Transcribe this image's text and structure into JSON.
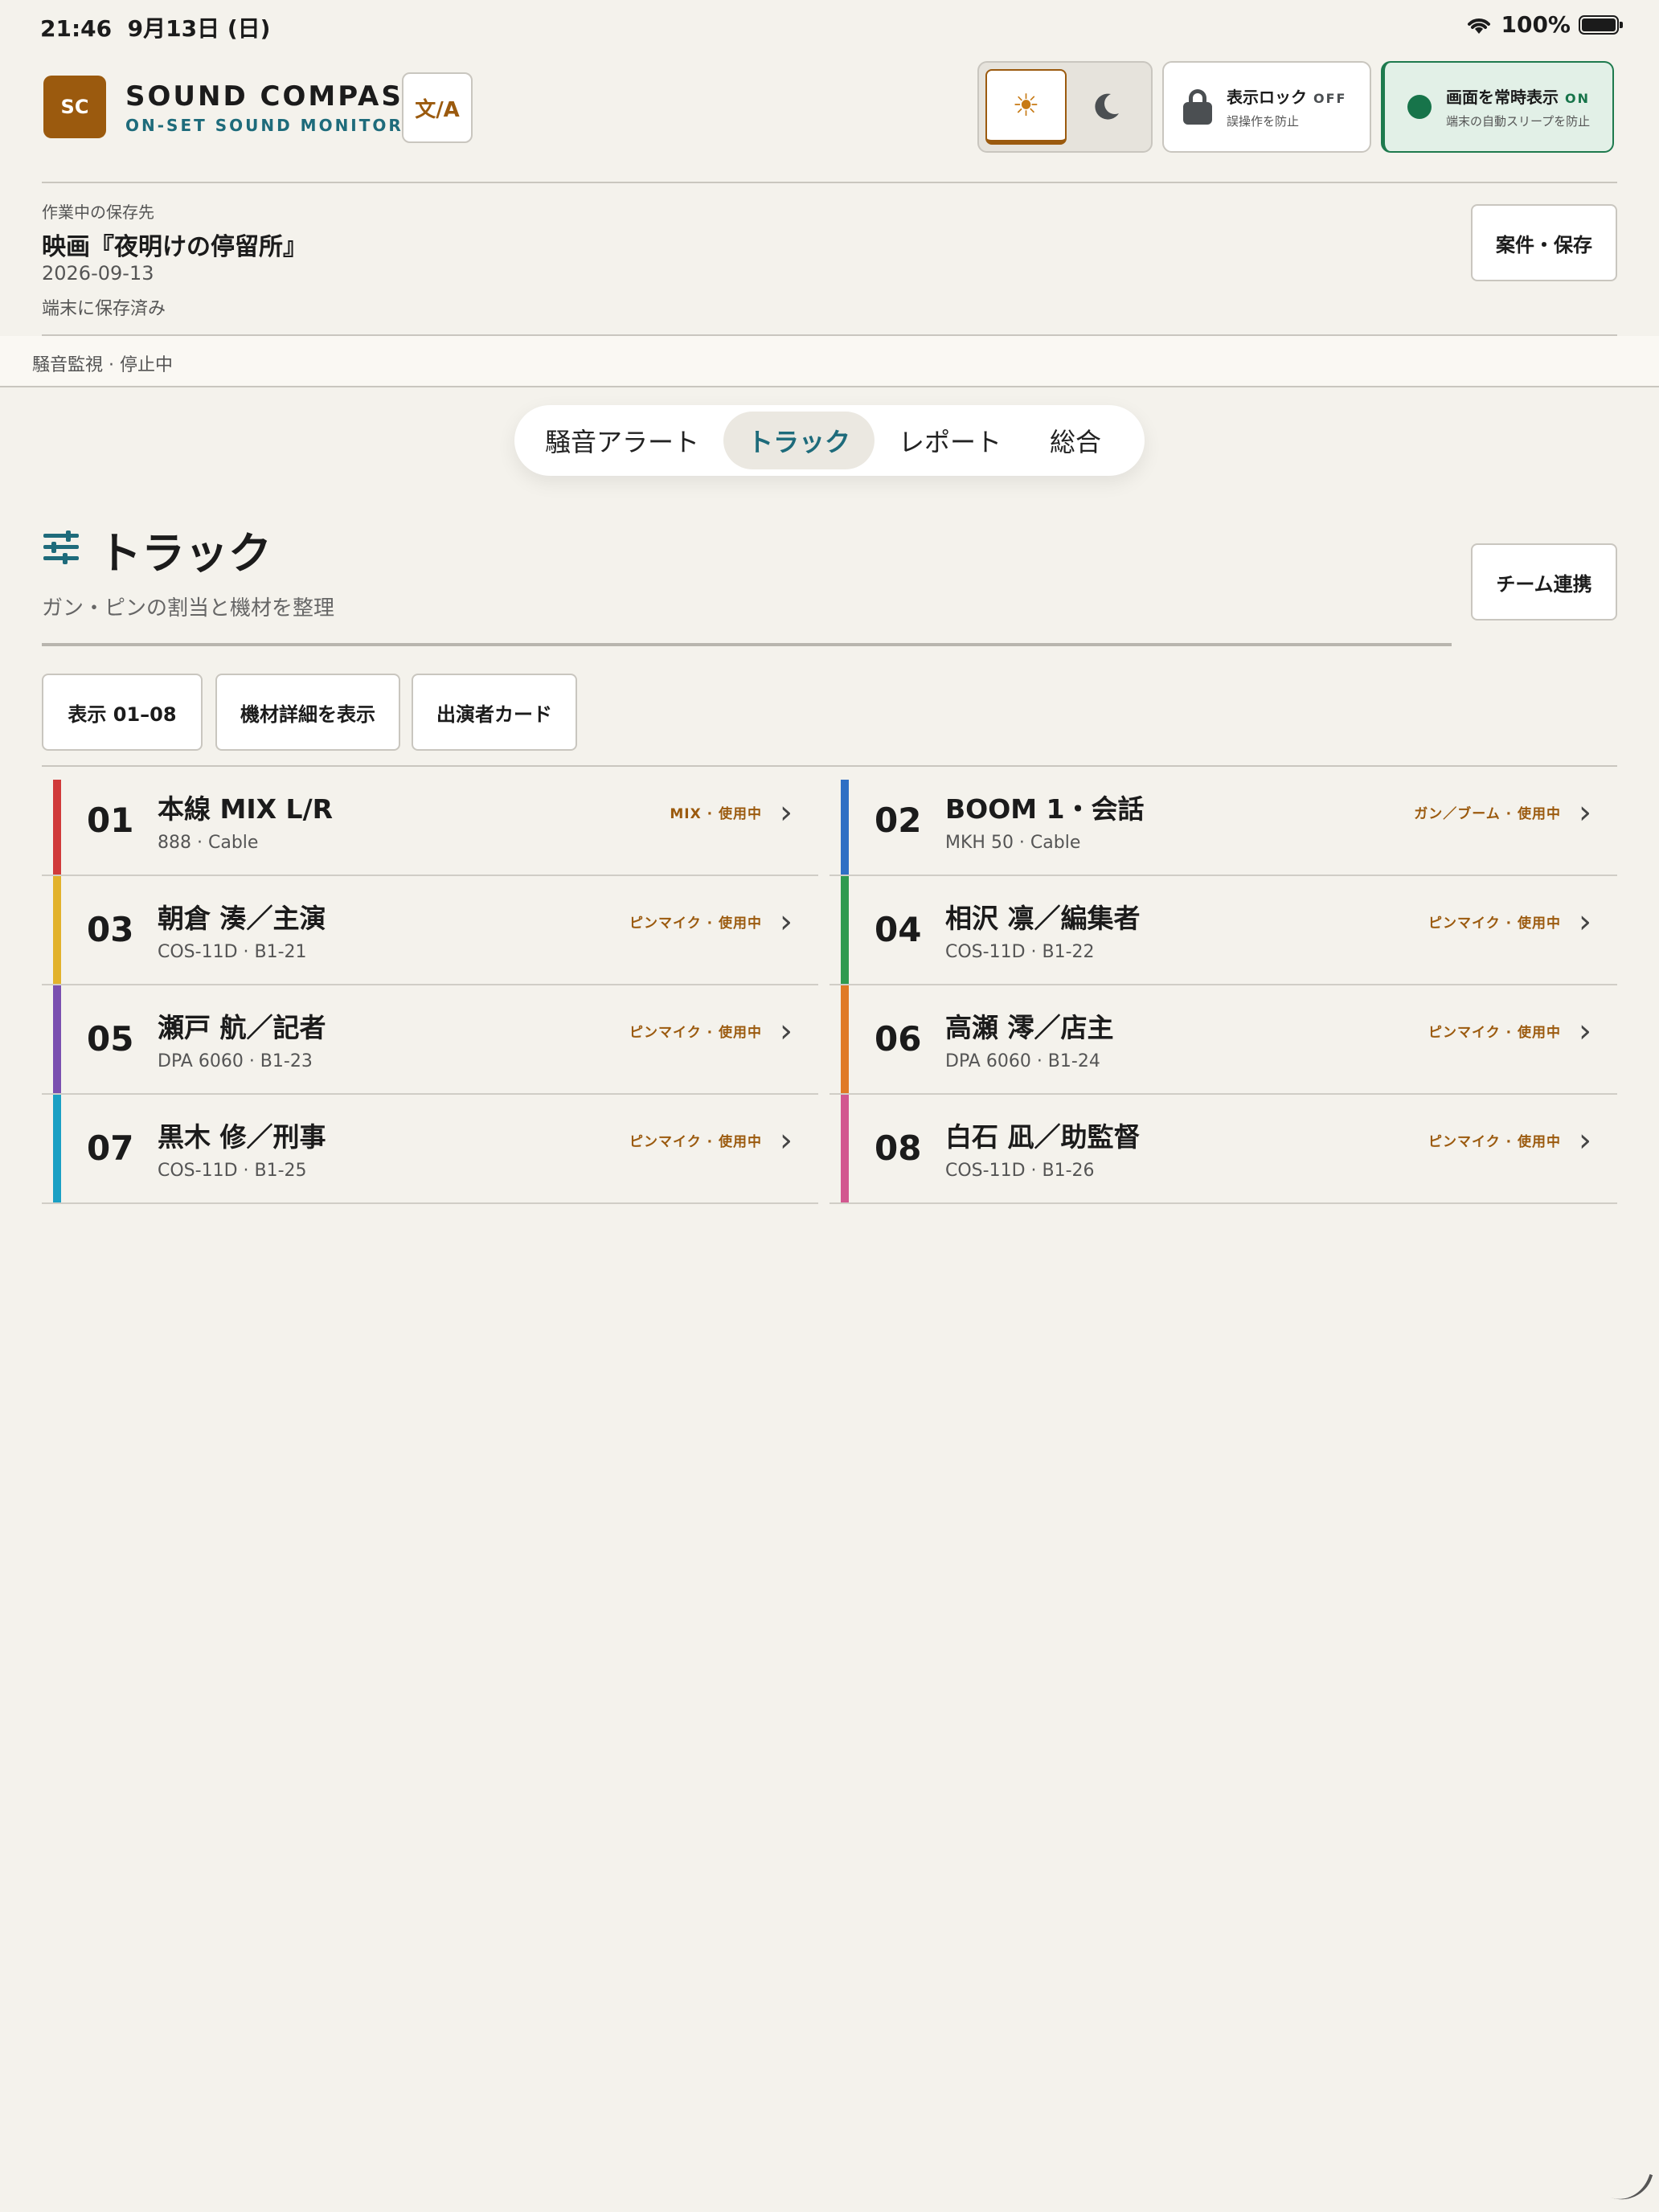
{
  "status_bar": {
    "time": "21:46",
    "date": "9月13日 (日)",
    "battery": "100%"
  },
  "brand": {
    "logo": "SC",
    "name": "SOUND COMPASS",
    "tagline": "ON-SET SOUND MONITOR",
    "lang_button": "文/A"
  },
  "theme": {
    "light_icon": "sun-icon",
    "dark_icon": "moon-icon",
    "selected": "light"
  },
  "display_lock": {
    "title": "表示ロック",
    "state": "OFF",
    "desc": "誤操作を防止"
  },
  "always_on": {
    "title": "画面を常時表示",
    "state": "ON",
    "desc": "端末の自動スリープを防止"
  },
  "project": {
    "label": "作業中の保存先",
    "title": "映画『夜明けの停留所』",
    "date": "2026-09-13",
    "status": "端末に保存済み",
    "save_button": "案件・保存"
  },
  "monitor": {
    "status": "騒音監視 · 停止中"
  },
  "tabs": [
    {
      "label": "騒音アラート"
    },
    {
      "label": "トラック"
    },
    {
      "label": "レポート"
    },
    {
      "label": "総合"
    }
  ],
  "section": {
    "title": "トラック",
    "subtitle": "ガン・ピンの割当と機材を整理",
    "team_button": "チーム連携"
  },
  "filters": [
    {
      "label": "表示 01–08"
    },
    {
      "label": "機材詳細を表示"
    },
    {
      "label": "出演者カード"
    }
  ],
  "tracks": [
    {
      "num": "01",
      "name": "本線 MIX L/R",
      "meta": "888 · Cable",
      "badge": "MIX · 使用中",
      "color": "#d03a3a"
    },
    {
      "num": "02",
      "name": "BOOM 1・会話",
      "meta": "MKH 50 · Cable",
      "badge": "ガン／ブーム · 使用中",
      "color": "#2f6fc4"
    },
    {
      "num": "03",
      "name": "朝倉 湊／主演",
      "meta": "COS-11D · B1-21",
      "badge": "ピンマイク · 使用中",
      "color": "#e2b22b"
    },
    {
      "num": "04",
      "name": "相沢 凛／編集者",
      "meta": "COS-11D · B1-22",
      "badge": "ピンマイク · 使用中",
      "color": "#2f9a4f"
    },
    {
      "num": "05",
      "name": "瀬戸 航／記者",
      "meta": "DPA 6060 · B1-23",
      "badge": "ピンマイク · 使用中",
      "color": "#7a4fb0"
    },
    {
      "num": "06",
      "name": "高瀬 澪／店主",
      "meta": "DPA 6060 · B1-24",
      "badge": "ピンマイク · 使用中",
      "color": "#e07a25"
    },
    {
      "num": "07",
      "name": "黒木 修／刑事",
      "meta": "COS-11D · B1-25",
      "badge": "ピンマイク · 使用中",
      "color": "#1aa0c4"
    },
    {
      "num": "08",
      "name": "白石 凪／助監督",
      "meta": "COS-11D · B1-26",
      "badge": "ピンマイク · 使用中",
      "color": "#d2578f"
    }
  ]
}
